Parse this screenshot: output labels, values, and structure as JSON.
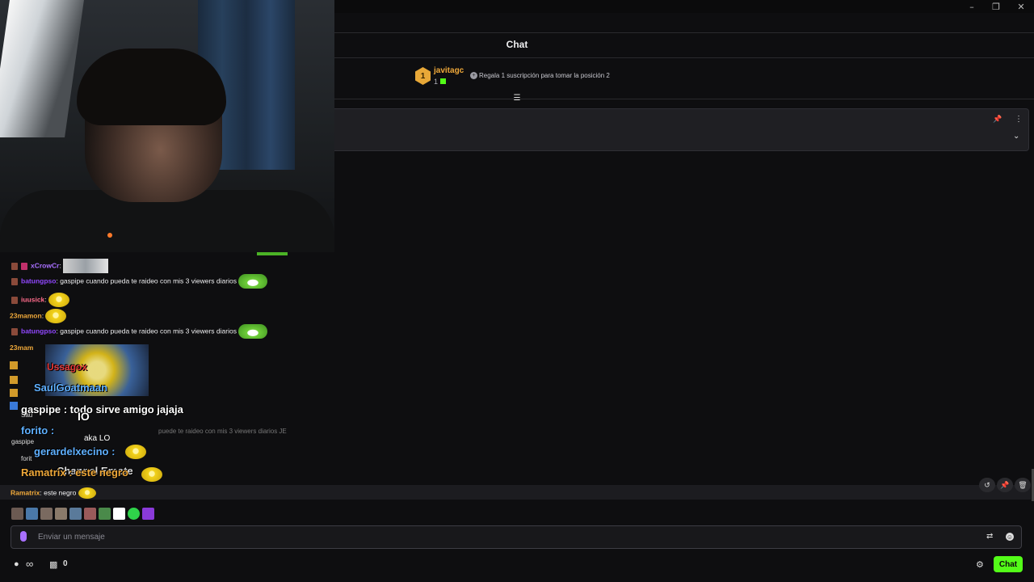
{
  "window": {
    "minimize": "–",
    "restore": "❐",
    "close": "✕"
  },
  "header": {
    "title": "Chat"
  },
  "leaderboard": {
    "rank": "1",
    "username": "javitagc",
    "count": "1",
    "gift_text": "Regala 1 suscripción para tomar la posición 2"
  },
  "messages": [
    {
      "user": "xCrowCr",
      "text": "",
      "color": "#a970ff"
    },
    {
      "user": "batungpso",
      "text": "gaspipe cuando pueda te raideo con mis 3 viewers diarios",
      "color": "#9147ff"
    },
    {
      "user": "iuusick",
      "text": "",
      "color": "#ff6b8b"
    },
    {
      "user": "23mamon",
      "text": "",
      "color": "#f0a93a"
    },
    {
      "user": "batungpso",
      "text": "gaspipe cuando pueda te raideo con mis 3 viewers diarios",
      "color": "#9147ff"
    },
    {
      "user": "23mam",
      "text": "",
      "color": "#f0a93a"
    }
  ],
  "overlay": {
    "user1": "Ussagox",
    "user2": "SaulGoatmaan",
    "gaspipe_line": "gaspipe : todo sirve amigo jajaja",
    "forito": "forito :",
    "gerardelxecino": "gerardelxecino :",
    "ramatrix_big": "Ramatrix : este negro",
    "channel_emote": "Channel Emote",
    "aka": "aka LO",
    "io": "IO",
    "faded_text": "puede te raideo con mis 3 viewers diarios JE",
    "gaspipe_small": "gaspipe",
    "sau": "Sau",
    "forit": "forit",
    "exchnum": "2"
  },
  "last_message": {
    "user": "Ramatrix",
    "text": "este negro"
  },
  "input": {
    "placeholder": "Enviar un mensaje"
  },
  "bottom": {
    "viewers": "∞",
    "gift_count": "0",
    "chat_button": "Chat"
  },
  "colors": {
    "accent": "#53fc18",
    "bg": "#0e0e10"
  },
  "icons": [
    "filter-icon",
    "pin-icon",
    "more-icon",
    "chevron-down-icon",
    "mic-icon",
    "translate-icon",
    "smile-icon",
    "gear-icon",
    "gift-icon",
    "people-icon",
    "undo-icon",
    "trash-icon"
  ]
}
